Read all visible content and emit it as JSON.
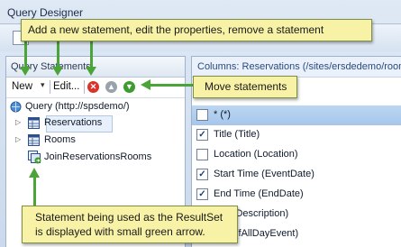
{
  "window": {
    "title": "Query Designer"
  },
  "left_pane": {
    "header": "Query Statements",
    "toolbar": {
      "new_label": "New",
      "edit_label": "Edit..."
    },
    "tree": {
      "root": "Query (http://spsdemo/)",
      "items": [
        "Reservations",
        "Rooms",
        "JoinReservationsRooms"
      ]
    }
  },
  "right_pane": {
    "header": "Columns: Reservations (/sites/ersdedemo/room",
    "columns": [
      {
        "label": "* (*)",
        "checked": false
      },
      {
        "label": "Title (Title)",
        "checked": true
      },
      {
        "label": "Location (Location)",
        "checked": false
      },
      {
        "label": "Start Time (EventDate)",
        "checked": true
      },
      {
        "label": "End Time (EndDate)",
        "checked": true
      },
      {
        "label": "tion (Description)",
        "checked": false
      },
      {
        "label": "vent (fAllDayEvent)",
        "checked": false
      }
    ]
  },
  "callouts": {
    "top": "Add a new statement, edit the properties, remove a statement",
    "move": "Move statements",
    "resultset_line1": "Statement being used as the ResultSet",
    "resultset_line2": "is displayed with small green arrow."
  },
  "colors": {
    "callout_bg": "#f7f2a6",
    "arrow": "#4aa437",
    "remove": "#d9342b",
    "move_down": "#3e9b2f",
    "move_up": "#9aa3ad"
  }
}
